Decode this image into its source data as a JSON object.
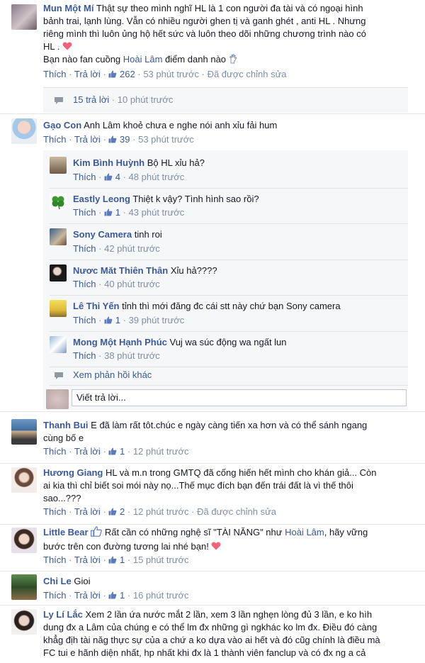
{
  "comments": [
    {
      "name": "Mun Một Mí",
      "lines": [
        "Thật sự theo mình nghĩ HL là 1 con người đa tài và có ngoại hình",
        "bảnh trai, lạnh lùng. Vẫn có nhiều người ghen tị và ganh ghét , anti HL . Nhưng",
        "riêng mình thì luôn ủng hộ hết sức và luôn theo dõi những chương trình nào có",
        "HL . ",
        "Bạn nào fan cuồng ",
        "Hoài Lâm",
        " điểm danh nào "
      ],
      "actions": {
        "like": "Thích",
        "reply": "Trả lời",
        "likes": "262",
        "time": "53 phút trước",
        "edited": "Đã được chỉnh sửa"
      },
      "replies_summary": {
        "count": "15 trả lời",
        "time": "10 phút trước"
      }
    },
    {
      "name": "Gạo Con",
      "text": "Anh Lâm khoẻ chưa e nghe nói anh xỉu fải hum",
      "actions": {
        "like": "Thích",
        "reply": "Trả lời",
        "likes": "39",
        "time": "53 phút trước"
      },
      "replies": [
        {
          "name": "Kim Bình Huỳnh",
          "text": "Bộ HL xỉu hả?",
          "like": "Thích",
          "likes": "4",
          "time": "48 phút trước"
        },
        {
          "name": "Eastly Leong",
          "text": "Thiệt k vậy? Tình hình sao rồi?",
          "like": "Thích",
          "likes": "1",
          "time": "43 phút trước"
        },
        {
          "name": "Sony Camera",
          "text": "tinh roi",
          "like": "Thích",
          "likes": "",
          "time": "42 phút trước"
        },
        {
          "name": "Nươc Măt Thiên Thân",
          "text": "Xỉu hả????",
          "like": "Thích",
          "likes": "",
          "time": "40 phút trước"
        },
        {
          "name": "Lê Thi Yến",
          "text": "tỉnh thì mới đăng đc cái stt này chứ bạn Sony camera",
          "like": "Thích",
          "likes": "1",
          "time": "39 phút trước"
        },
        {
          "name": "Mong Một Hạnh Phúc",
          "text": "Vuj wa súc động wa ngất lun",
          "like": "Thích",
          "likes": "",
          "time": "38 phút trước"
        }
      ],
      "more_replies": "Xem phản hồi khác",
      "reply_placeholder": "Viết trả lời..."
    },
    {
      "name": "Thanh Bui",
      "lines": [
        "E đã làm rất tôt.chúc e ngày càng tiến xa hơn và có thể sánh ngang",
        "cùng bố e"
      ],
      "actions": {
        "like": "Thích",
        "reply": "Trả lời",
        "likes": "1",
        "time": "12 phút trước"
      }
    },
    {
      "name": "Hương Giang",
      "lines": [
        "HL và m.n trong GMTQ đã cống hiến hết mình cho khán giả... Còn",
        "ai kia thì chỉ biết soi mói này nọ...Thế mục đích bạn đến trái đất là vì thế thôi",
        "sao...???"
      ],
      "actions": {
        "like": "Thích",
        "reply": "Trả lời",
        "likes": "2",
        "time": "12 phút trước",
        "edited": "Đã được chỉnh sửa"
      }
    },
    {
      "name": "Little Bear",
      "lines": [
        "Rất cần có những nghệ sĩ \"TÀI NĂNG\" như ",
        "Hoài Lâm",
        ", hãy vững",
        "bước trên con đường tương lai nhé bạn! "
      ],
      "actions": {
        "like": "Thích",
        "reply": "Trả lời",
        "likes": "1",
        "time": "15 phút trước"
      }
    },
    {
      "name": "Chi Le",
      "text": "Gioi",
      "actions": {
        "like": "Thích",
        "reply": "Trả lời",
        "likes": "1",
        "time": "16 phút trước"
      }
    },
    {
      "name": "Ly Lí Lắc",
      "lines": [
        "Xem 2 lần ứa nước mắt 2 lần, xem 3 lần nghẹn lòng đủ 3 lần, e ko hìh",
        "dung đx a Lâm của chúng e có thể lm đx những gì ngkhác ko lm đx. Điều đó càng",
        "khẳg địh tài năg thực sự của a chứ a ko dựa vào ai hết và đó cũg chính là điều mà",
        "FC tui e hãnh diện nhất, hp nhất khi đx là 1 thành viên fanclup và có đx ng a cả"
      ]
    }
  ],
  "separator": "·",
  "colors": {
    "link": "#3b5998",
    "meta": "#7f8fa4",
    "reply_bg": "#f6f7f9"
  }
}
